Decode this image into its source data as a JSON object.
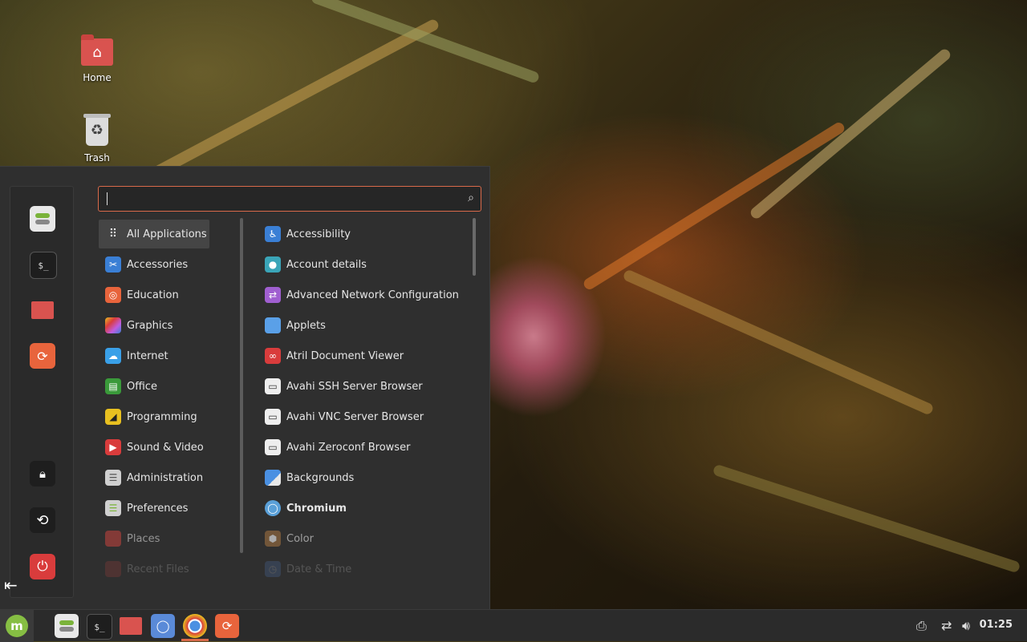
{
  "desktop": {
    "icons": [
      {
        "label": "Home",
        "icon": "home-folder-icon"
      },
      {
        "label": "Trash",
        "icon": "trash-icon"
      }
    ]
  },
  "menu": {
    "search": {
      "value": "",
      "placeholder": ""
    },
    "favorites": [
      {
        "name": "settings-favorite",
        "icon": "toggle-settings-icon",
        "color": "#e8e8e8"
      },
      {
        "name": "terminal-favorite",
        "icon": "terminal-icon",
        "color": "#1e1e1e"
      },
      {
        "name": "files-favorite",
        "icon": "folder-icon",
        "color": "#d9534f"
      },
      {
        "name": "firefox-favorite",
        "icon": "firefox-icon",
        "color": "#e8643c"
      }
    ],
    "session": [
      {
        "name": "lock-screen-button",
        "icon": "lock-icon"
      },
      {
        "name": "logout-button",
        "icon": "logout-icon"
      },
      {
        "name": "quit-button",
        "icon": "power-icon"
      }
    ],
    "categories": [
      {
        "label": "All Applications",
        "icon": "grid-icon",
        "color": "#444444",
        "selected": true
      },
      {
        "label": "Accessories",
        "icon": "scissors-icon",
        "color": "#3a7fd5"
      },
      {
        "label": "Education",
        "icon": "education-icon",
        "color": "#e8643c"
      },
      {
        "label": "Graphics",
        "icon": "graphics-icon",
        "color": "#c05de0"
      },
      {
        "label": "Internet",
        "icon": "cloud-icon",
        "color": "#3aa0e8"
      },
      {
        "label": "Office",
        "icon": "office-icon",
        "color": "#3a9a3a"
      },
      {
        "label": "Programming",
        "icon": "programming-icon",
        "color": "#e8c020"
      },
      {
        "label": "Sound & Video",
        "icon": "play-icon",
        "color": "#d93c3c"
      },
      {
        "label": "Administration",
        "icon": "admin-toggle-icon",
        "color": "#d0d0d0"
      },
      {
        "label": "Preferences",
        "icon": "preferences-toggle-icon",
        "color": "#d0d0d0"
      },
      {
        "label": "Places",
        "icon": "folder-icon",
        "color": "#c9433f"
      },
      {
        "label": "Recent Files",
        "icon": "folder-icon",
        "color": "#c9433f"
      }
    ],
    "applications": [
      {
        "label": "Accessibility",
        "icon": "accessibility-icon",
        "color": "#3a7fd5"
      },
      {
        "label": "Account details",
        "icon": "account-icon",
        "color": "#3aa5b8"
      },
      {
        "label": "Advanced Network Configuration",
        "icon": "network-icon",
        "color": "#a05fd0"
      },
      {
        "label": "Applets",
        "icon": "applets-icon",
        "color": "#5aa0e8"
      },
      {
        "label": "Atril Document Viewer",
        "icon": "atril-icon",
        "color": "#d93c3c"
      },
      {
        "label": "Avahi SSH Server Browser",
        "icon": "monitor-icon",
        "color": "#3a3a3a"
      },
      {
        "label": "Avahi VNC Server Browser",
        "icon": "monitor-icon",
        "color": "#3a3a3a"
      },
      {
        "label": "Avahi Zeroconf Browser",
        "icon": "monitor-icon",
        "color": "#3a3a3a"
      },
      {
        "label": "Backgrounds",
        "icon": "backgrounds-icon",
        "color": "#4a90e2"
      },
      {
        "label": "Chromium",
        "icon": "chromium-icon",
        "color": "#5aa0d8",
        "bold": true
      },
      {
        "label": "Color",
        "icon": "color-icon",
        "color": "#a07040"
      },
      {
        "label": "Date & Time",
        "icon": "clock-icon",
        "color": "#5a8ad8"
      }
    ]
  },
  "panel": {
    "menu_button_icon": "mint-logo-icon",
    "tasks": [
      {
        "name": "settings-launcher",
        "icon": "toggle-settings-icon",
        "color": "#e8e8e8"
      },
      {
        "name": "terminal-launcher",
        "icon": "terminal-icon",
        "color": "#1e1e1e"
      },
      {
        "name": "files-launcher",
        "icon": "folder-icon",
        "color": "#d9534f"
      },
      {
        "name": "web-browser-launcher",
        "icon": "browser-icon",
        "color": "#5a8ad8"
      },
      {
        "name": "chromium-launcher",
        "icon": "chromium-icon",
        "color": "#e8e8e8",
        "active": true
      },
      {
        "name": "firefox-launcher",
        "icon": "firefox-icon",
        "color": "#e8643c"
      }
    ],
    "tray": [
      "printer-icon",
      "network-icon",
      "volume-icon"
    ],
    "clock": "01:25"
  }
}
